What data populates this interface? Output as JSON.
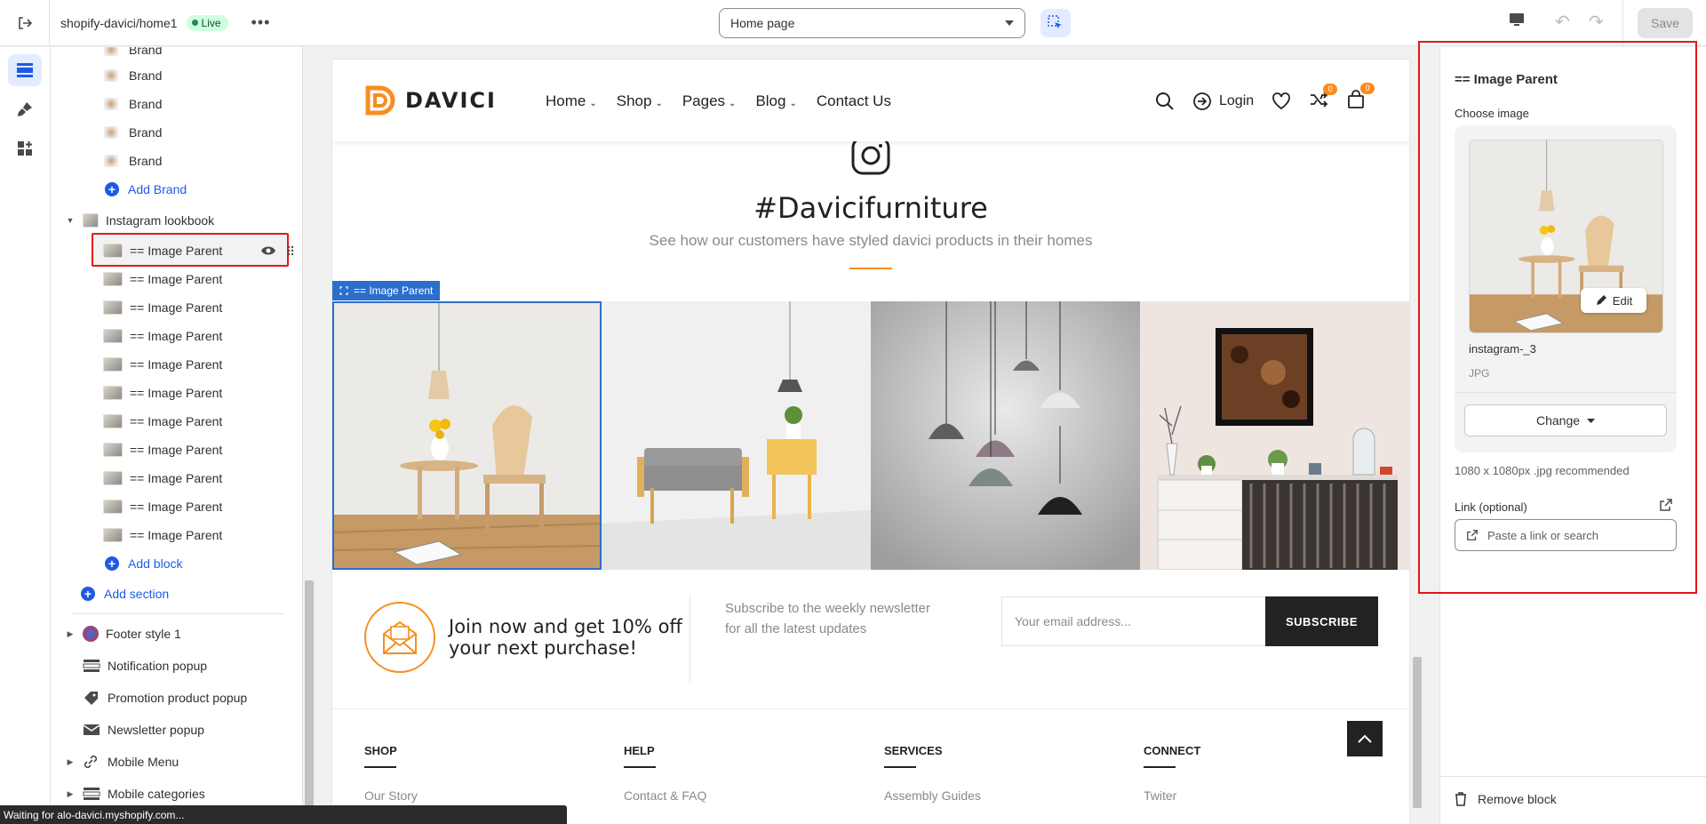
{
  "topbar": {
    "store_name": "shopify-davici/home1",
    "live_badge": "Live",
    "template_select": "Home page",
    "save_label": "Save"
  },
  "tree": {
    "brands": [
      "Brand",
      "Brand",
      "Brand",
      "Brand",
      "Brand"
    ],
    "brand_top_partial": "Brand",
    "add_brand": "Add Brand",
    "instagram_section": "Instagram lookbook",
    "image_blocks": [
      "== Image Parent",
      "== Image Parent",
      "== Image Parent",
      "== Image Parent",
      "== Image Parent",
      "== Image Parent",
      "== Image Parent",
      "== Image Parent",
      "== Image Parent",
      "== Image Parent",
      "== Image Parent"
    ],
    "add_block": "Add block",
    "add_section": "Add section",
    "footer_sections": [
      "Footer style 1",
      "Notification popup",
      "Promotion product popup",
      "Newsletter popup",
      "Mobile Menu",
      "Mobile categories"
    ]
  },
  "site": {
    "logo": "DAVICI",
    "nav": [
      "Home",
      "Shop",
      "Pages",
      "Blog",
      "Contact Us"
    ],
    "login": "Login",
    "compare_count": "0",
    "cart_count": "0",
    "insta_title": "#Davicifurniture",
    "insta_subtitle": "See how our customers have styled davici products in their homes",
    "selected_tag": "== Image Parent",
    "newsletter_heading": "Join now and get 10% off your next purchase!",
    "newsletter_text": "Subscribe to the weekly newsletter for all the latest updates",
    "email_placeholder": "Your email address...",
    "subscribe": "SUBSCRIBE",
    "footer_cols": [
      {
        "title": "SHOP",
        "link": "Our Story"
      },
      {
        "title": "HELP",
        "link": "Contact & FAQ"
      },
      {
        "title": "SERVICES",
        "link": "Assembly Guides"
      },
      {
        "title": "CONNECT",
        "link": "Twiter"
      }
    ]
  },
  "settings": {
    "title": "== Image Parent",
    "choose_image": "Choose image",
    "edit": "Edit",
    "file_name": "instagram-_3",
    "file_type": "JPG",
    "change": "Change",
    "recommendation": "1080 x 1080px .jpg recommended",
    "link_label": "Link (optional)",
    "link_placeholder": "Paste a link or search",
    "remove": "Remove block"
  },
  "statusbar": "Waiting for alo-davici.myshopify.com...",
  "colors": {
    "accent": "#f98d1f",
    "primary_blue": "#2c6ecb",
    "link_blue": "#1f5ae6",
    "highlight_red": "#e4161a",
    "live_green": "#29845a"
  }
}
